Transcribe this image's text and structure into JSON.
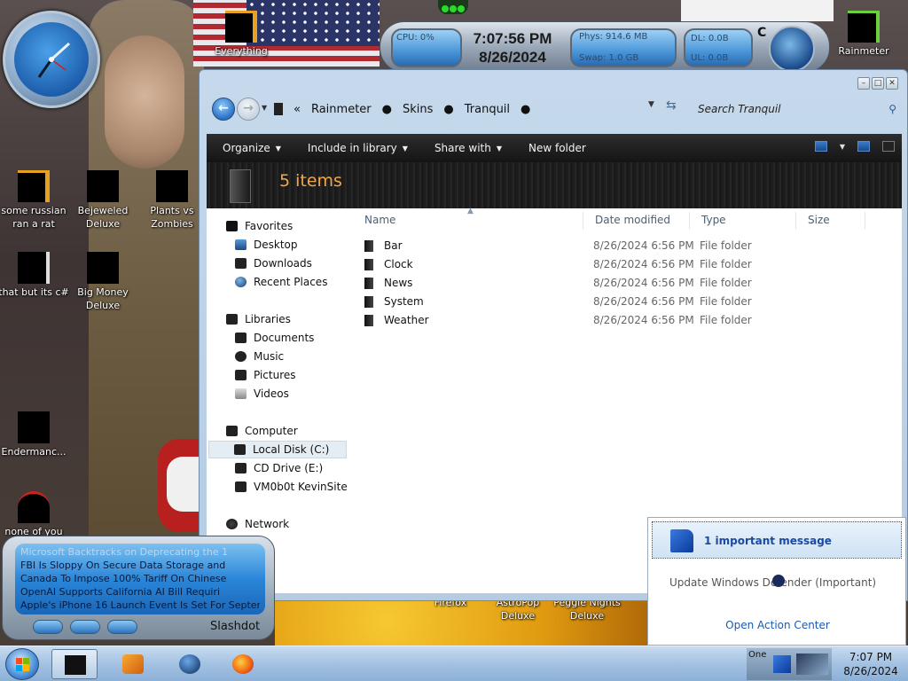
{
  "desktop": {
    "icons": [
      {
        "label": "Everything"
      },
      {
        "label": "Rainmeter"
      },
      {
        "label": "some russian ran a rat"
      },
      {
        "label": "Bejeweled Deluxe"
      },
      {
        "label": "Plants vs Zombies"
      },
      {
        "label": "that but its c#"
      },
      {
        "label": "Big Money Deluxe"
      },
      {
        "label": "Endermanc..."
      },
      {
        "label": "none of you"
      },
      {
        "label": "Firefox"
      },
      {
        "label": "AstroPop Deluxe"
      },
      {
        "label": "Peggle Nights Deluxe"
      }
    ]
  },
  "rainmeter": {
    "cpu": "CPU: 0%",
    "time": "7:07:56 PM",
    "date": "8/26/2024",
    "phys": "Phys: 914.6 MB",
    "swap": "Swap: 1.0 GB",
    "dl": "DL: 0.0B",
    "ul": "UL: 0.0B",
    "drive": "C"
  },
  "explorer": {
    "breadcrumb": [
      "Rainmeter",
      "Skins",
      "Tranquil"
    ],
    "breadcrumb_prefix": "«",
    "search_placeholder": "Search Tranquil",
    "toolbar": {
      "organize": "Organize",
      "include": "Include in library",
      "share": "Share with",
      "new_folder": "New folder"
    },
    "item_count": "5 items",
    "nav": {
      "favorites": "Favorites",
      "desktop": "Desktop",
      "downloads": "Downloads",
      "recent": "Recent Places",
      "libraries": "Libraries",
      "documents": "Documents",
      "music": "Music",
      "pictures": "Pictures",
      "videos": "Videos",
      "computer": "Computer",
      "local_disk": "Local Disk (C:)",
      "cd_drive": "CD Drive (E:)",
      "vm_share": "VM0b0t KevinSite",
      "network": "Network"
    },
    "columns": {
      "name": "Name",
      "date": "Date modified",
      "type": "Type",
      "size": "Size"
    },
    "files": [
      {
        "name": "Bar",
        "date": "8/26/2024 6:56 PM",
        "type": "File folder"
      },
      {
        "name": "Clock",
        "date": "8/26/2024 6:56 PM",
        "type": "File folder"
      },
      {
        "name": "News",
        "date": "8/26/2024 6:56 PM",
        "type": "File folder"
      },
      {
        "name": "System",
        "date": "8/26/2024 6:56 PM",
        "type": "File folder"
      },
      {
        "name": "Weather",
        "date": "8/26/2024 6:56 PM",
        "type": "File folder"
      }
    ]
  },
  "slashdot": {
    "title": "Slashdot",
    "headlines": [
      "Microsoft Backtracks on Deprecating the 1",
      "FBI Is Sloppy On Secure Data Storage and",
      "Canada To Impose 100% Tariff On Chinese",
      "OpenAI Supports California AI Bill Requiri",
      "Apple's iPhone 16 Launch Event Is Set For September"
    ]
  },
  "notification": {
    "title": "1 important message",
    "message": "Update Windows Defender (Important)",
    "link": "Open Action Center"
  },
  "taskbar": {
    "tray_text": "One",
    "time": "7:07 PM",
    "date": "8/26/2024"
  }
}
